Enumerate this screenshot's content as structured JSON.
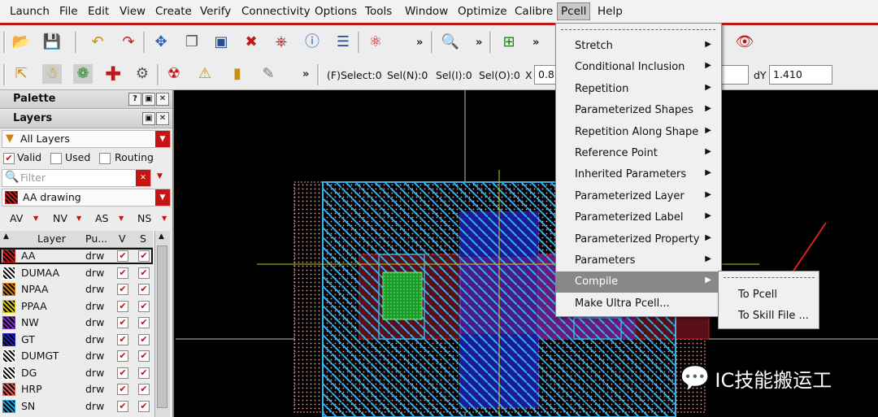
{
  "menubar": {
    "items": [
      "Launch",
      "File",
      "Edit",
      "View",
      "Create",
      "Verify",
      "Connectivity",
      "Options",
      "Tools",
      "Window",
      "Optimize",
      "Calibre",
      "Pcell",
      "Help"
    ],
    "active": "Pcell"
  },
  "toolbar": {
    "status": {
      "fselect": "(F)Select:0",
      "seln": "Sel(N):0",
      "seli": "Sel(I):0",
      "selo": "Sel(O):0",
      "x_label": "X",
      "x_value": "0.8",
      "dy_label": "dY",
      "dy_value": "1.410"
    },
    "more": "»"
  },
  "palette": {
    "title": "Palette",
    "layers_title": "Layers",
    "filter_set": "All Layers",
    "valid_label": "Valid",
    "used_label": "Used",
    "routing_label": "Routing",
    "filter_placeholder": "Filter",
    "current_layer": "AA drawing",
    "vis_buttons": [
      "AV",
      "NV",
      "AS",
      "NS"
    ],
    "columns": [
      "Layer",
      "Pu...",
      "V",
      "S"
    ],
    "rows": [
      {
        "name": "AA",
        "purpose": "drw",
        "color": "#c81e1e"
      },
      {
        "name": "DUMAA",
        "purpose": "drw",
        "color": "#ffffff"
      },
      {
        "name": "NPAA",
        "purpose": "drw",
        "color": "#d47a10"
      },
      {
        "name": "PPAA",
        "purpose": "drw",
        "color": "#d4c014"
      },
      {
        "name": "NW",
        "purpose": "drw",
        "color": "#8030c0"
      },
      {
        "name": "GT",
        "purpose": "drw",
        "color": "#2020c0"
      },
      {
        "name": "DUMGT",
        "purpose": "drw",
        "color": "#ffffff"
      },
      {
        "name": "DG",
        "purpose": "drw",
        "color": "#ffffff"
      },
      {
        "name": "HRP",
        "purpose": "drw",
        "color": "#e06060"
      },
      {
        "name": "SN",
        "purpose": "drw",
        "color": "#1aa0d8"
      }
    ]
  },
  "pcell_menu": {
    "items": [
      {
        "label": "Stretch",
        "submenu": true
      },
      {
        "label": "Conditional Inclusion",
        "submenu": true
      },
      {
        "label": "Repetition",
        "submenu": true
      },
      {
        "label": "Parameterized Shapes",
        "submenu": true
      },
      {
        "label": "Repetition Along Shape",
        "submenu": true
      },
      {
        "label": "Reference Point",
        "submenu": true
      },
      {
        "label": "Inherited Parameters",
        "submenu": true
      },
      {
        "label": "Parameterized Layer",
        "submenu": true
      },
      {
        "label": "Parameterized Label",
        "submenu": true
      },
      {
        "label": "Parameterized Property",
        "submenu": true
      },
      {
        "label": "Parameters",
        "submenu": true
      },
      {
        "label": "Compile",
        "submenu": true,
        "highlighted": true
      },
      {
        "label": "Make Ultra Pcell...",
        "submenu": false
      }
    ]
  },
  "compile_submenu": {
    "items": [
      "To Pcell",
      "To Skill File ..."
    ]
  },
  "watermark": {
    "text": "IC技能搬运工"
  },
  "colors": {
    "menu_accent": "#c01818",
    "highlight": "#888888",
    "annotation_arrow": "#e02020"
  }
}
